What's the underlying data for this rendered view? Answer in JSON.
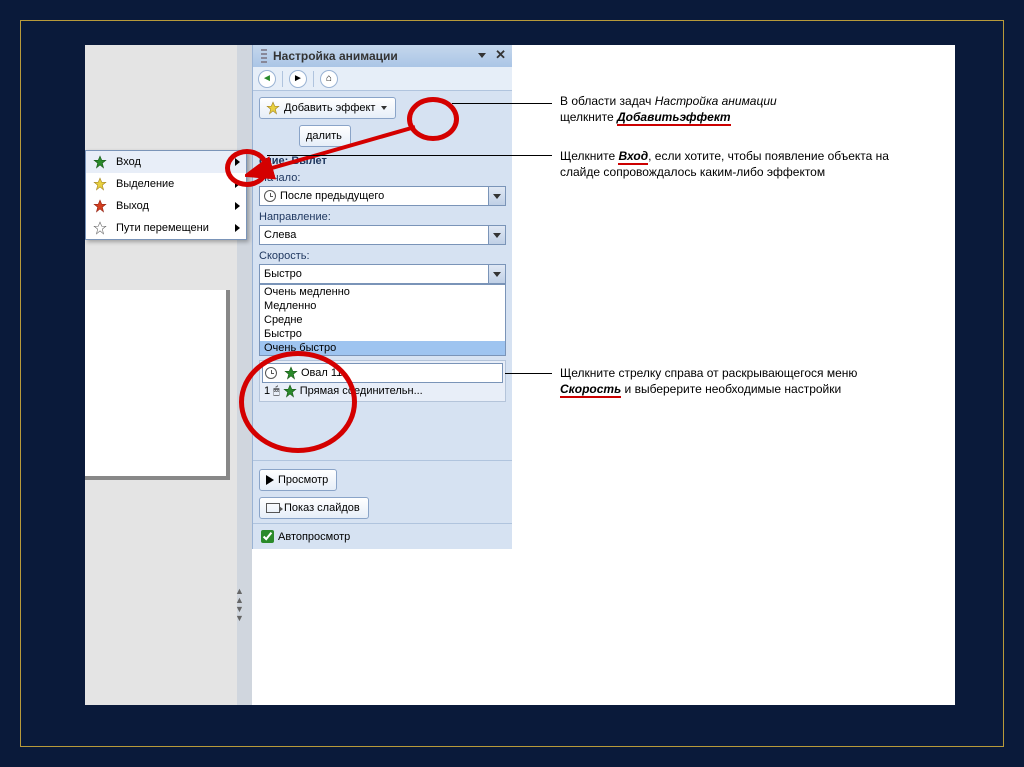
{
  "pane": {
    "title": "Настройка анимации",
    "add_effect": "Добавить эффект",
    "remove": "далить",
    "change_label": "ение: Вылет",
    "start_label": "Начало:",
    "start_value": "После предыдущего",
    "direction_label": "Направление:",
    "direction_value": "Слева",
    "speed_label": "Скорость:",
    "speed_value": "Быстро",
    "speed_options": [
      "Очень медленно",
      "Медленно",
      "Средне",
      "Быстро",
      "Очень быстро"
    ],
    "obj1": "Овал 11",
    "obj2": "Прямая соединительн...",
    "obj2_prefix": "1",
    "preview": "Просмотр",
    "slideshow": "Показ слайдов",
    "autopreview": "Автопросмотр"
  },
  "menu": {
    "items": [
      {
        "label": "Вход",
        "color": "#2a8a2a"
      },
      {
        "label": "Выделение",
        "color": "#d4b020"
      },
      {
        "label": "Выход",
        "color": "#d44020"
      },
      {
        "label": "Пути перемещени",
        "color": "#888"
      }
    ]
  },
  "annotations": {
    "a1_pre": "В области задач ",
    "a1_em": "Настройка анимации",
    "a1_line2_pre": "щелкните ",
    "a1_line2_u": "Добавитьэффект",
    "a2_pre": "Щелкните ",
    "a2_u": "Вход",
    "a2_post": ", если хотите, чтобы появление объекта на слайде сопровождалось каким-либо эффектом",
    "a3_pre": "Щелкните стрелку справа от раскрывающегося меню ",
    "a3_u": "Скорость",
    "a3_post": " и выберерите необходимые настройки"
  }
}
